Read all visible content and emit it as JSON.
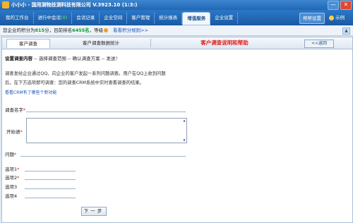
{
  "window": {
    "title": "小小小 - 国用测物技测科技有限公司 V.3923.10 (1:3:) ",
    "minimize_glyph": "—",
    "close_glyph": "✕"
  },
  "nav": {
    "tabs": [
      {
        "label": "我的工作台"
      },
      {
        "label": "进行中会话",
        "count": "(0)"
      },
      {
        "label": "会话记录"
      },
      {
        "label": "企业空间"
      },
      {
        "label": "客户管理"
      },
      {
        "label": "统计报表"
      },
      {
        "label": "增值服务"
      },
      {
        "label": "企业设置"
      }
    ],
    "help_label": "帮帮设置",
    "user_label": "示例"
  },
  "info": {
    "prefix": "您企业的积分为",
    "points": "815",
    "middle": "分，目前排名",
    "rank": "6455名",
    "level_label": "，等级",
    "link": "看看积分规则>>",
    "arrow": "▲"
  },
  "subtabs": {
    "tab1": "客户调查",
    "tab2": "客户调查数据统计",
    "tab3": "客户调查说明和帮助",
    "back": "<<返回"
  },
  "content": {
    "steps_bold": "设置调查内容",
    "steps_rest": " -- 选择调查范围 -- 确认调查方案 -- 发送！",
    "desc1": "调查发给企业通过QQ、向企业的客户发起一系列问题调查。用户在QQ上收到问题",
    "desc2": "后，在下方选项即可调查：您的调查CRM系统中实时查看调查的结果。",
    "help_link": "看看CRM有了哪些个新功能"
  },
  "form": {
    "name_label": "调查名字",
    "intro_label": "开始语",
    "question_label": "问题",
    "option1_label": "选项1",
    "option2_label": "选项2",
    "option3_label": "选项3",
    "option4_label": "选项4",
    "required_mark": "*",
    "spin_up": "▲",
    "spin_down": "▼",
    "next_label": "下一步"
  }
}
